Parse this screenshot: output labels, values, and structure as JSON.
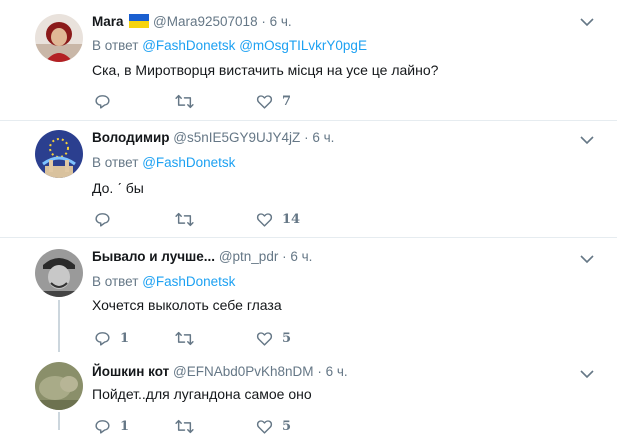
{
  "colors": {
    "accent": "#1da1f2",
    "muted": "#657786",
    "text": "#14171a",
    "separator": "#e6ecf0",
    "thread": "#ccd6dd"
  },
  "icons": {
    "reply": "reply-icon",
    "retweet": "retweet-icon",
    "like": "heart-icon",
    "more": "chevron-down-icon",
    "flag": "ukraine-flag-icon"
  },
  "tweets": [
    {
      "name": "Mara",
      "handle": "@Mara92507018",
      "dot": "·",
      "time": "6 ч.",
      "reply_prefix": "В ответ",
      "mentions": [
        "@FashDonetsk",
        "@mOsgTILvkrY0pgE"
      ],
      "text": "Ска, в Миротворця вистачить місця на усе це лайно?",
      "replies": "",
      "retweets": "",
      "likes": "7"
    },
    {
      "name": "Володимир",
      "handle": "@s5nIE5GY9UJY4jZ",
      "dot": "·",
      "time": "6 ч.",
      "reply_prefix": "В ответ",
      "mentions": [
        "@FashDonetsk"
      ],
      "text": "До. ˊ бы",
      "replies": "",
      "retweets": "",
      "likes": "14"
    },
    {
      "name": "Бывало и лучше...",
      "handle": "@ptn_pdr",
      "dot": "·",
      "time": "6 ч.",
      "reply_prefix": "В ответ",
      "mentions": [
        "@FashDonetsk"
      ],
      "text": "Хочется выколоть себе глаза",
      "replies": "1",
      "retweets": "",
      "likes": "5"
    },
    {
      "name": "Йошкин кот",
      "handle": "@EFNAbd0PvKh8nDM",
      "dot": "·",
      "time": "6 ч.",
      "text": "Пойдет..для лугандона самое оно",
      "replies": "1",
      "retweets": "",
      "likes": "5"
    }
  ]
}
